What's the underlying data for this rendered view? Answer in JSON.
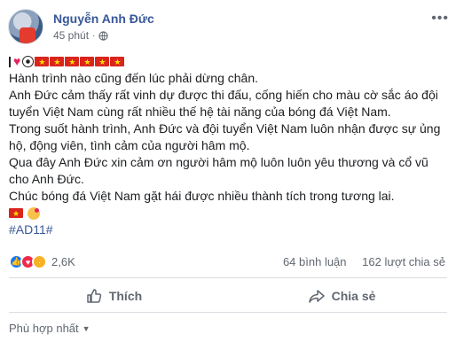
{
  "post": {
    "author": "Nguyễn Anh Đức",
    "time": "45 phút",
    "lines": [
      "Hành trình nào cũng đến lúc phải dừng chân.",
      "Anh Đức cảm thấy rất vinh dự được thi đấu, cống hiến cho màu cờ sắc áo đội",
      "tuyển Việt Nam cùng rất nhiều thế hệ tài năng của bóng đá Việt Nam.",
      "Trong suốt hành trình, Anh Đức và đội tuyển Việt Nam luôn nhận được sự ủng",
      "hộ, động viên, tình cảm của người hâm mộ.",
      "Qua đây Anh Đức xin cảm ơn người hâm mộ luôn luôn yêu thương và cổ vũ",
      "cho Anh Đức.",
      "Chúc bóng đá Việt Nam gặt hái được nhiều thành tích trong tương lai."
    ],
    "hashtag": "#AD11#"
  },
  "stats": {
    "reactions_count": "2,6K",
    "comments": "64 bình luận",
    "shares": "162 lượt chia sẻ"
  },
  "actions": {
    "like": "Thích",
    "share": "Chia sẻ"
  },
  "comments_sort": "Phù hợp nhất",
  "colors": {
    "link": "#385898",
    "text": "#1c1e21",
    "muted": "#606770",
    "like_blue": "#1877f2",
    "love_red": "#f0284a",
    "flag_red": "#da251d"
  }
}
